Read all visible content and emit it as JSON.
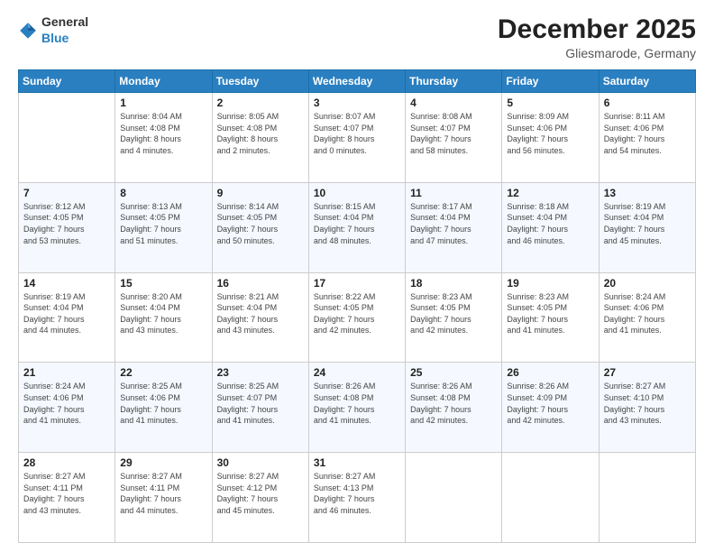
{
  "header": {
    "logo_general": "General",
    "logo_blue": "Blue",
    "title": "December 2025",
    "subtitle": "Gliesmarode, Germany"
  },
  "weekdays": [
    "Sunday",
    "Monday",
    "Tuesday",
    "Wednesday",
    "Thursday",
    "Friday",
    "Saturday"
  ],
  "weeks": [
    [
      {
        "day": "",
        "info": ""
      },
      {
        "day": "1",
        "info": "Sunrise: 8:04 AM\nSunset: 4:08 PM\nDaylight: 8 hours\nand 4 minutes."
      },
      {
        "day": "2",
        "info": "Sunrise: 8:05 AM\nSunset: 4:08 PM\nDaylight: 8 hours\nand 2 minutes."
      },
      {
        "day": "3",
        "info": "Sunrise: 8:07 AM\nSunset: 4:07 PM\nDaylight: 8 hours\nand 0 minutes."
      },
      {
        "day": "4",
        "info": "Sunrise: 8:08 AM\nSunset: 4:07 PM\nDaylight: 7 hours\nand 58 minutes."
      },
      {
        "day": "5",
        "info": "Sunrise: 8:09 AM\nSunset: 4:06 PM\nDaylight: 7 hours\nand 56 minutes."
      },
      {
        "day": "6",
        "info": "Sunrise: 8:11 AM\nSunset: 4:06 PM\nDaylight: 7 hours\nand 54 minutes."
      }
    ],
    [
      {
        "day": "7",
        "info": "Sunrise: 8:12 AM\nSunset: 4:05 PM\nDaylight: 7 hours\nand 53 minutes."
      },
      {
        "day": "8",
        "info": "Sunrise: 8:13 AM\nSunset: 4:05 PM\nDaylight: 7 hours\nand 51 minutes."
      },
      {
        "day": "9",
        "info": "Sunrise: 8:14 AM\nSunset: 4:05 PM\nDaylight: 7 hours\nand 50 minutes."
      },
      {
        "day": "10",
        "info": "Sunrise: 8:15 AM\nSunset: 4:04 PM\nDaylight: 7 hours\nand 48 minutes."
      },
      {
        "day": "11",
        "info": "Sunrise: 8:17 AM\nSunset: 4:04 PM\nDaylight: 7 hours\nand 47 minutes."
      },
      {
        "day": "12",
        "info": "Sunrise: 8:18 AM\nSunset: 4:04 PM\nDaylight: 7 hours\nand 46 minutes."
      },
      {
        "day": "13",
        "info": "Sunrise: 8:19 AM\nSunset: 4:04 PM\nDaylight: 7 hours\nand 45 minutes."
      }
    ],
    [
      {
        "day": "14",
        "info": "Sunrise: 8:19 AM\nSunset: 4:04 PM\nDaylight: 7 hours\nand 44 minutes."
      },
      {
        "day": "15",
        "info": "Sunrise: 8:20 AM\nSunset: 4:04 PM\nDaylight: 7 hours\nand 43 minutes."
      },
      {
        "day": "16",
        "info": "Sunrise: 8:21 AM\nSunset: 4:04 PM\nDaylight: 7 hours\nand 43 minutes."
      },
      {
        "day": "17",
        "info": "Sunrise: 8:22 AM\nSunset: 4:05 PM\nDaylight: 7 hours\nand 42 minutes."
      },
      {
        "day": "18",
        "info": "Sunrise: 8:23 AM\nSunset: 4:05 PM\nDaylight: 7 hours\nand 42 minutes."
      },
      {
        "day": "19",
        "info": "Sunrise: 8:23 AM\nSunset: 4:05 PM\nDaylight: 7 hours\nand 41 minutes."
      },
      {
        "day": "20",
        "info": "Sunrise: 8:24 AM\nSunset: 4:06 PM\nDaylight: 7 hours\nand 41 minutes."
      }
    ],
    [
      {
        "day": "21",
        "info": "Sunrise: 8:24 AM\nSunset: 4:06 PM\nDaylight: 7 hours\nand 41 minutes."
      },
      {
        "day": "22",
        "info": "Sunrise: 8:25 AM\nSunset: 4:06 PM\nDaylight: 7 hours\nand 41 minutes."
      },
      {
        "day": "23",
        "info": "Sunrise: 8:25 AM\nSunset: 4:07 PM\nDaylight: 7 hours\nand 41 minutes."
      },
      {
        "day": "24",
        "info": "Sunrise: 8:26 AM\nSunset: 4:08 PM\nDaylight: 7 hours\nand 41 minutes."
      },
      {
        "day": "25",
        "info": "Sunrise: 8:26 AM\nSunset: 4:08 PM\nDaylight: 7 hours\nand 42 minutes."
      },
      {
        "day": "26",
        "info": "Sunrise: 8:26 AM\nSunset: 4:09 PM\nDaylight: 7 hours\nand 42 minutes."
      },
      {
        "day": "27",
        "info": "Sunrise: 8:27 AM\nSunset: 4:10 PM\nDaylight: 7 hours\nand 43 minutes."
      }
    ],
    [
      {
        "day": "28",
        "info": "Sunrise: 8:27 AM\nSunset: 4:11 PM\nDaylight: 7 hours\nand 43 minutes."
      },
      {
        "day": "29",
        "info": "Sunrise: 8:27 AM\nSunset: 4:11 PM\nDaylight: 7 hours\nand 44 minutes."
      },
      {
        "day": "30",
        "info": "Sunrise: 8:27 AM\nSunset: 4:12 PM\nDaylight: 7 hours\nand 45 minutes."
      },
      {
        "day": "31",
        "info": "Sunrise: 8:27 AM\nSunset: 4:13 PM\nDaylight: 7 hours\nand 46 minutes."
      },
      {
        "day": "",
        "info": ""
      },
      {
        "day": "",
        "info": ""
      },
      {
        "day": "",
        "info": ""
      }
    ]
  ]
}
